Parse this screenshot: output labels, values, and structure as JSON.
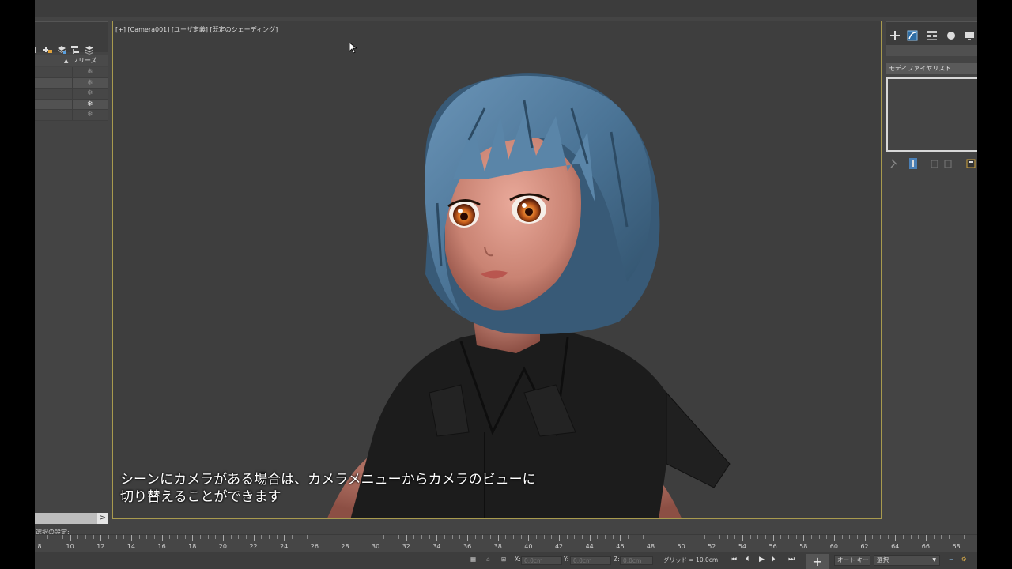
{
  "scene_explorer": {
    "column_header": "フリーズ",
    "rows": [
      {
        "freeze_icon": "snowflake",
        "selected": false
      },
      {
        "freeze_icon": "snowflake",
        "selected": true
      },
      {
        "freeze_icon": "snowflake",
        "selected": false
      },
      {
        "freeze_icon": "snowflake",
        "selected": true
      },
      {
        "freeze_icon": "snowflake",
        "selected": false
      }
    ],
    "selection_setting_label": "選択の設定:",
    "scroll_arrow": ">"
  },
  "viewport": {
    "label": "[+] [Camera001] [ユーザ定義] [既定のシェーディング]",
    "subtitle_line1": "シーンにカメラがある場合は、カメラメニューからカメラのビューに",
    "subtitle_line2": "切り替えることができます",
    "border_color": "#a89a4e"
  },
  "command_panel": {
    "modifier_list_label": "モディファイヤリスト",
    "tabs": [
      "create-icon",
      "modify-icon",
      "hierarchy-icon",
      "motion-icon",
      "display-icon"
    ]
  },
  "timeline": {
    "ticks": [
      "8",
      "10",
      "12",
      "14",
      "16",
      "18",
      "20",
      "22",
      "24",
      "26",
      "28",
      "30",
      "32",
      "34",
      "36",
      "38",
      "40",
      "42",
      "44",
      "46",
      "48",
      "50",
      "52",
      "54",
      "56",
      "58",
      "60",
      "62",
      "64",
      "66",
      "68"
    ]
  },
  "status_bar": {
    "x_label": "X:",
    "x_value": "0.0cm",
    "y_label": "Y:",
    "y_value": "0.0cm",
    "z_label": "Z:",
    "z_value": "0.0cm",
    "grid_text": "グリッド = 10.0cm",
    "auto_key_label": "オート キー",
    "selection_dropdown": "選択"
  }
}
